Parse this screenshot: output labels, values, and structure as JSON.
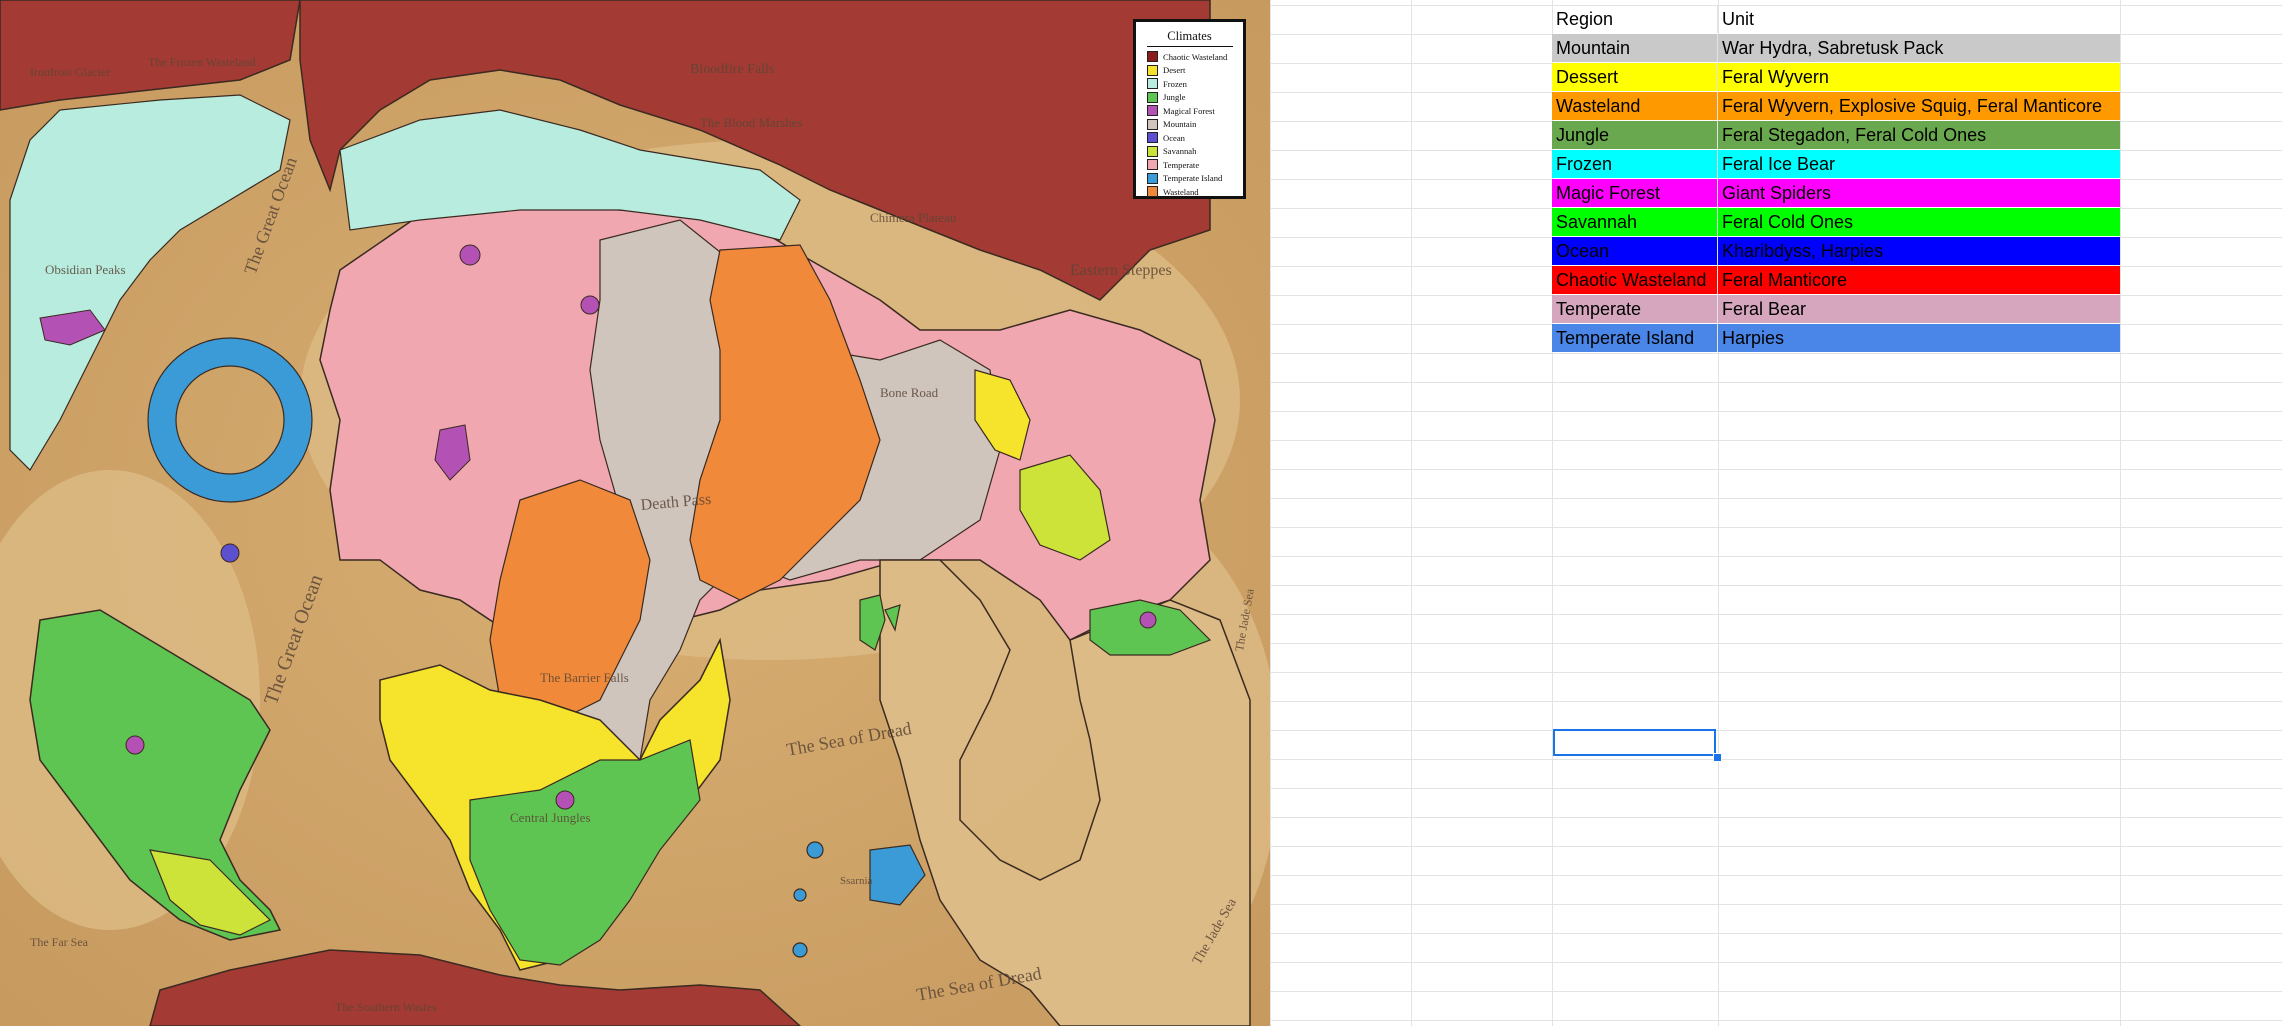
{
  "map": {
    "legend_title": "Climates",
    "legend": [
      {
        "label": "Chaotic Wasteland",
        "color": "#8b1c1c"
      },
      {
        "label": "Desert",
        "color": "#f5e32c"
      },
      {
        "label": "Frozen",
        "color": "#b7ecdf"
      },
      {
        "label": "Jungle",
        "color": "#5fc552"
      },
      {
        "label": "Magical Forest",
        "color": "#b451b4"
      },
      {
        "label": "Mountain",
        "color": "#cfc5bd"
      },
      {
        "label": "Ocean",
        "color": "#5c4fd0"
      },
      {
        "label": "Savannah",
        "color": "#cde33a"
      },
      {
        "label": "Temperate",
        "color": "#f1a7b0"
      },
      {
        "label": "Temperate Island",
        "color": "#3a9bd6"
      },
      {
        "label": "Wasteland",
        "color": "#f08a3a"
      }
    ],
    "labels": [
      {
        "text": "Ironfrost Glacier",
        "cls": "small"
      },
      {
        "text": "The Frozen Wasteland",
        "cls": "small"
      },
      {
        "text": "Bloodfire Falls",
        "cls": "small"
      },
      {
        "text": "The Blood Marshes",
        "cls": "small"
      },
      {
        "text": "Chimera Plateau",
        "cls": "small"
      },
      {
        "text": "Eastern Steppes",
        "cls": "mid"
      },
      {
        "text": "The Great Ocean",
        "cls": "big"
      },
      {
        "text": "The Great Ocean",
        "cls": "big"
      },
      {
        "text": "The Sea of Dread",
        "cls": "big"
      },
      {
        "text": "The Sea of Dread",
        "cls": "big"
      },
      {
        "text": "The Far Sea",
        "cls": "small"
      },
      {
        "text": "The Jade Sea",
        "cls": "small"
      },
      {
        "text": "The Jade Sea",
        "cls": "small"
      },
      {
        "text": "The Southern Wastes",
        "cls": "small"
      },
      {
        "text": "Death Pass",
        "cls": "mid"
      },
      {
        "text": "Bone Road",
        "cls": "small"
      },
      {
        "text": "The Barrier Falls",
        "cls": "small"
      },
      {
        "text": "Central Jungles",
        "cls": "small"
      },
      {
        "text": "Obsidian Peaks",
        "cls": "small"
      },
      {
        "text": "Ssarnia",
        "cls": "small"
      }
    ]
  },
  "table": {
    "header": {
      "region": "Region",
      "unit": "Unit"
    },
    "rows": [
      {
        "region": "Mountain",
        "unit": "War Hydra, Sabretusk Pack",
        "bg": "#c9c9c9"
      },
      {
        "region": "Dessert",
        "unit": "Feral Wyvern",
        "bg": "#ffff00"
      },
      {
        "region": "Wasteland",
        "unit": "Feral Wyvern, Explosive Squig, Feral Manticore",
        "bg": "#ff9900"
      },
      {
        "region": "Jungle",
        "unit": "Feral Stegadon, Feral Cold Ones",
        "bg": "#6aa84f"
      },
      {
        "region": "Frozen",
        "unit": "Feral Ice Bear",
        "bg": "#00ffff"
      },
      {
        "region": "Magic Forest",
        "unit": "Giant Spiders",
        "bg": "#ff00ff"
      },
      {
        "region": "Savannah",
        "unit": "Feral Cold Ones",
        "bg": "#00ff00"
      },
      {
        "region": "Ocean",
        "unit": "Kharibdyss, Harpies",
        "bg": "#0000ff"
      },
      {
        "region": "Chaotic Wasteland",
        "unit": "Feral Manticore",
        "bg": "#ff0000"
      },
      {
        "region": "Temperate",
        "unit": "Feral Bear",
        "bg": "#d5a6bd"
      },
      {
        "region": "Temperate Island",
        "unit": "Harpies",
        "bg": "#4a86e8"
      }
    ]
  }
}
